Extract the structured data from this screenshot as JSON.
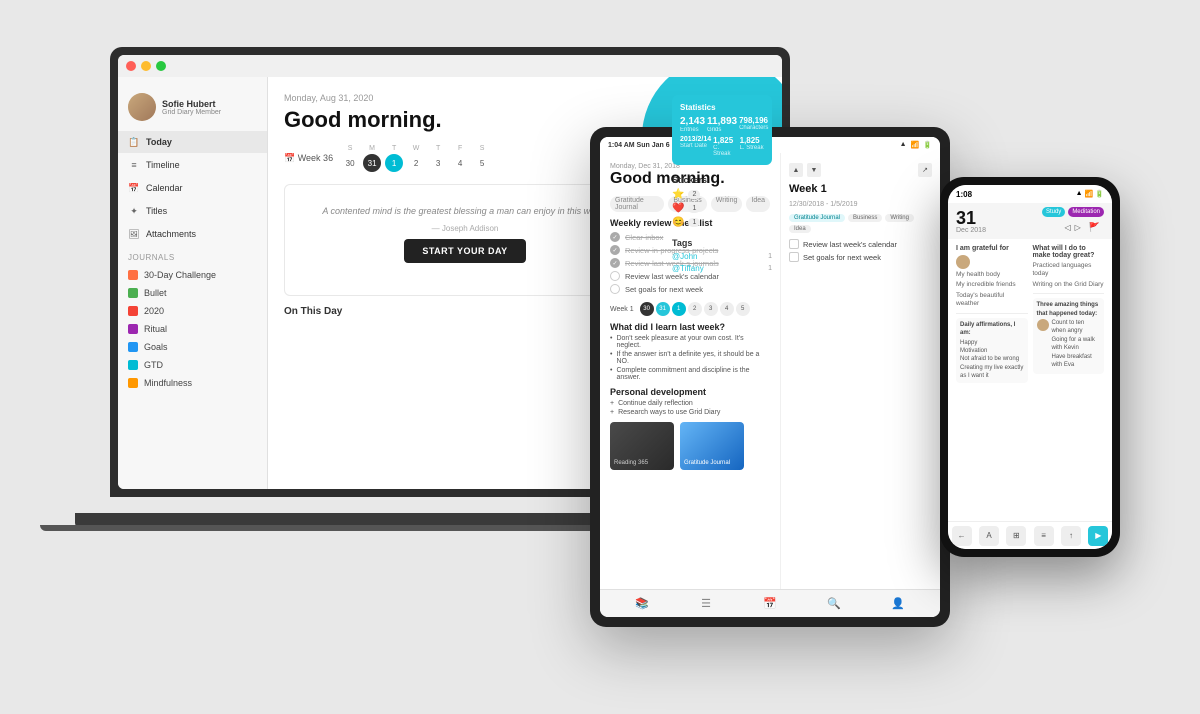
{
  "scene": {
    "bg": "#e8e8e8"
  },
  "laptop": {
    "titlebar_dots": [
      "red",
      "yellow",
      "green"
    ],
    "sidebar": {
      "user_name": "Sofie Hubert",
      "user_role": "Grid Diary Member",
      "nav_items": [
        {
          "label": "Today",
          "icon": "📋",
          "active": true
        },
        {
          "label": "Timeline",
          "icon": "≡"
        },
        {
          "label": "Calendar",
          "icon": "📅"
        },
        {
          "label": "Titles",
          "icon": "✦"
        },
        {
          "label": "Attachments",
          "icon": "🖼"
        }
      ],
      "journals_label": "Journals",
      "journals": [
        {
          "label": "30-Day Challenge",
          "color": "#FF7043"
        },
        {
          "label": "Bullet",
          "color": "#4CAF50"
        },
        {
          "label": "2020",
          "color": "#F44336"
        },
        {
          "label": "Ritual",
          "color": "#9C27B0"
        },
        {
          "label": "Goals",
          "color": "#2196F3"
        },
        {
          "label": "GTD",
          "color": "#00BCD4"
        },
        {
          "label": "Mindfulness",
          "color": "#FF9800"
        }
      ]
    },
    "main": {
      "date": "Monday, Aug 31, 2020",
      "greeting": "Good morning.",
      "week_label": "Week 36",
      "week_day_labels": [
        "S",
        "M",
        "T",
        "W",
        "T",
        "F",
        "S"
      ],
      "week_days": [
        "30",
        "31",
        "1",
        "2",
        "3",
        "4",
        "5"
      ],
      "selected_day": "1",
      "today_day": "31",
      "quote": "A contented mind is the greatest blessing a man can enjoy in this world.",
      "quote_author": "— Joseph Addison",
      "start_day_button": "START YOUR DAY",
      "on_this_day": "On This Day"
    },
    "stats": {
      "title": "Statistics",
      "entries_value": "2,143",
      "entries_label": "Entries",
      "grids_value": "11,893",
      "grids_label": "Grids",
      "chars_value": "798,196",
      "chars_label": "Characters",
      "start_date_value": "2013/2/14",
      "start_date_label": "Start Date",
      "c_streak_value": "1,825",
      "c_streak_label": "C. Streak",
      "l_streak_value": "1,825",
      "l_streak_label": "L. Streak"
    },
    "stickers": {
      "title": "Stickers",
      "items": [
        {
          "emoji": "⭐",
          "count": "2"
        },
        {
          "emoji": "❤️",
          "count": "1"
        },
        {
          "emoji": "😊",
          "count": "1"
        }
      ]
    },
    "tags": {
      "title": "Tags",
      "items": [
        {
          "label": "@John",
          "count": "1"
        },
        {
          "label": "@Tiffany",
          "count": "1"
        }
      ]
    }
  },
  "tablet": {
    "status_bar": {
      "time": "1:04 AM  Sun Jan 6"
    },
    "main": {
      "date": "Monday, Dec 31, 2018",
      "greeting": "Good morning.",
      "journals_tags": [
        "Gratitude Journal",
        "Business",
        "Writing",
        "Idea"
      ],
      "checklist_title": "Weekly review checklist",
      "checklist_items": [
        {
          "text": "Clear-inbox",
          "checked": true
        },
        {
          "text": "Review-in-progress-projects",
          "checked": true
        },
        {
          "text": "Review-last-week-s-journals",
          "checked": true
        },
        {
          "text": "Review last week's calendar",
          "checked": false
        },
        {
          "text": "Set goals for next week",
          "checked": false
        }
      ],
      "week_label": "Week 1",
      "week_days": [
        "30",
        "31",
        "1",
        "2",
        "3",
        "4",
        "5"
      ],
      "learn_title": "What did I learn last week?",
      "learn_items": [
        "Don't seek pleasure at your own cost. It's neglect.",
        "If the answer isn't a definite yes, it should be a NO.",
        "Complete commitment and discipline is the answer."
      ],
      "personal_title": "Personal development",
      "personal_items": [
        "Continue daily reflection",
        "Research ways to use Grid Diary"
      ],
      "journal_images": [
        {
          "label": "Reading 365",
          "style": "dark"
        },
        {
          "label": "Gratitude Journal",
          "style": "blue"
        }
      ]
    },
    "right": {
      "week_label": "Week 1",
      "date_range": "12/30/2018 - 1/5/2019",
      "badges": [
        "Gratitude Journal",
        "Business",
        "Writing",
        "Idea"
      ],
      "checklist_items": [
        "Review last week's calendar",
        "Set goals for next week"
      ]
    },
    "bottom_icons": [
      "📚",
      "☰",
      "📅",
      "🔍",
      "👤"
    ]
  },
  "phone": {
    "status": {
      "time": "1:08",
      "icons": "▲ 📶 🔋"
    },
    "header": {
      "day": "31",
      "month_year": "Dec 2018",
      "badges": [
        "Study",
        "Meditation"
      ],
      "flag": "🚩"
    },
    "sections": {
      "grateful_title": "I am grateful for",
      "grateful_items": [
        "My health body",
        "My incredible friends",
        "Today's beautiful weather"
      ],
      "great_title": "What will I do to make today great?",
      "great_items": [
        "Practiced languages today",
        "Writing on the Grid Diary"
      ],
      "affirmations_title": "Daily affirmations, I am:",
      "affirmations_items": [
        "Happy",
        "Motivation",
        "Not afraid to be wrong",
        "Creating my live exactly as I want it"
      ],
      "amazing_title": "Three amazing things that happened today:",
      "amazing_items": [
        "Count to ten when angry",
        "Going for a walk with Kevin",
        "Have breakfast with Eva"
      ]
    },
    "bottom_bar": [
      "←",
      "A",
      "⊞",
      "≡",
      "↑",
      "▶"
    ]
  }
}
